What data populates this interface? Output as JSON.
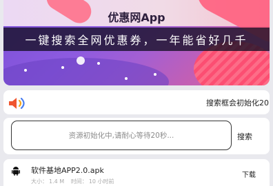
{
  "banner": {
    "title": "优惠网App",
    "slogan": "一键搜索全网优惠券，一年能省好几千"
  },
  "notice": {
    "icon": "speaker-icon",
    "text": "搜索框会初始化20"
  },
  "search": {
    "placeholder": "资源初始化中,请耐心等待20秒...",
    "button_label": "搜索"
  },
  "file": {
    "icon": "android-icon",
    "name": "软件基地APP2.0.apk",
    "size_label": "大小：",
    "size_value": "1.4 M",
    "time_label": "时间：",
    "time_value": "10 小时前",
    "action_label": "下载"
  }
}
